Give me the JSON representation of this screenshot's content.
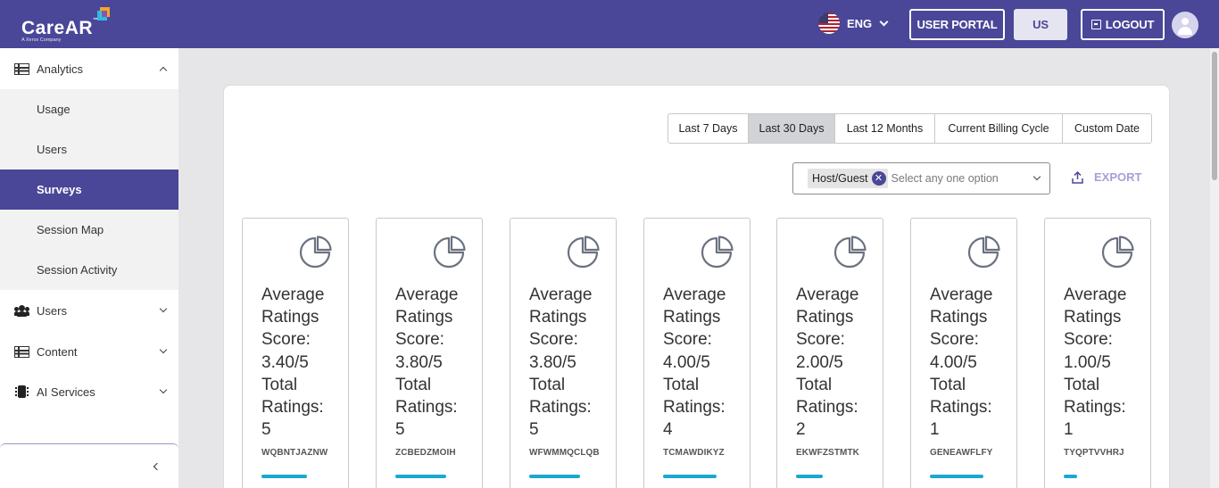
{
  "header": {
    "logo_text": "CareAR",
    "logo_tm": "™",
    "logo_sub": "A Xerox Company",
    "language": "ENG",
    "user_portal_label": "USER PORTAL",
    "region_label": "US",
    "logout_label": "LOGOUT",
    "brand_color": "#4a4698"
  },
  "sidebar": {
    "groups": [
      {
        "label": "Analytics",
        "icon": "table-icon",
        "expanded": true
      },
      {
        "label": "Users",
        "icon": "users-icon",
        "expanded": false
      },
      {
        "label": "Content",
        "icon": "table-icon",
        "expanded": false
      },
      {
        "label": "AI Services",
        "icon": "chip-icon",
        "expanded": false
      }
    ],
    "analytics_items": [
      {
        "label": "Usage",
        "active": false
      },
      {
        "label": "Users",
        "active": false
      },
      {
        "label": "Surveys",
        "active": true
      },
      {
        "label": "Session Map",
        "active": false
      },
      {
        "label": "Session Activity",
        "active": false
      }
    ]
  },
  "filters": {
    "ranges": [
      "Last 7 Days",
      "Last 30 Days",
      "Last 12 Months",
      "Current Billing Cycle",
      "Custom Date"
    ],
    "active_range": "Last 30 Days",
    "selected_chip": "Host/Guest",
    "chip_remove": "✕",
    "placeholder": "Select any one option",
    "export_label": "EXPORT"
  },
  "cards": [
    {
      "line1": "Average",
      "line2": "Ratings",
      "line3": "Score:",
      "score": "3.40/5",
      "total1": "Total",
      "total2": "Ratings:",
      "count": "5",
      "code": "WQBNTJAZNW",
      "progress": 0.68
    },
    {
      "line1": "Average",
      "line2": "Ratings",
      "line3": "Score:",
      "score": "3.80/5",
      "total1": "Total",
      "total2": "Ratings:",
      "count": "5",
      "code": "ZCBEDZMOIH",
      "progress": 0.76
    },
    {
      "line1": "Average",
      "line2": "Ratings",
      "line3": "Score:",
      "score": "3.80/5",
      "total1": "Total",
      "total2": "Ratings:",
      "count": "5",
      "code": "WFWMMQCLQB",
      "progress": 0.76
    },
    {
      "line1": "Average",
      "line2": "Ratings",
      "line3": "Score:",
      "score": "4.00/5",
      "total1": "Total",
      "total2": "Ratings:",
      "count": "4",
      "code": "TCMAWDIKYZ",
      "progress": 0.8
    },
    {
      "line1": "Average",
      "line2": "Ratings",
      "line3": "Score:",
      "score": "2.00/5",
      "total1": "Total",
      "total2": "Ratings:",
      "count": "2",
      "code": "EKWFZSTMTK",
      "progress": 0.4
    },
    {
      "line1": "Average",
      "line2": "Ratings",
      "line3": "Score:",
      "score": "4.00/5",
      "total1": "Total",
      "total2": "Ratings:",
      "count": "1",
      "code": "GENEAWFLFY",
      "progress": 0.8
    },
    {
      "line1": "Average",
      "line2": "Ratings",
      "line3": "Score:",
      "score": "1.00/5",
      "total1": "Total",
      "total2": "Ratings:",
      "count": "1",
      "code": "TYQPTVVHRJ",
      "progress": 0.2
    }
  ]
}
